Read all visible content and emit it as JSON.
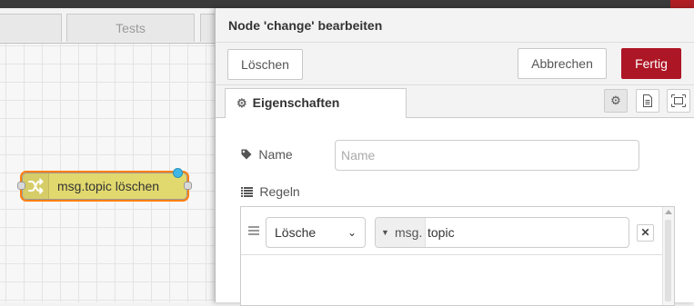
{
  "workspace": {
    "tabs": [
      {
        "label": ""
      },
      {
        "label": "Tests"
      },
      {
        "label": ""
      }
    ],
    "node": {
      "label": "msg.topic löschen",
      "icon": "shuffle-icon"
    }
  },
  "tray": {
    "title": "Node 'change' bearbeiten",
    "buttons": {
      "delete": "Löschen",
      "cancel": "Abbrechen",
      "done": "Fertig"
    },
    "tabs": {
      "properties": "Eigenschaften",
      "icons": [
        "gear-icon",
        "document-icon",
        "frame-icon"
      ]
    },
    "form": {
      "name_label": "Name",
      "name_placeholder": "Name",
      "name_value": "",
      "rules_label": "Regeln"
    },
    "rule": {
      "action": "Lösche",
      "type_prefix": "msg.",
      "property": "topic"
    }
  },
  "colors": {
    "node_fill": "#e2d96e",
    "node_selected": "#ff7f0e",
    "primary_button": "#ad1625",
    "status_dot": "#3eb7e6"
  }
}
